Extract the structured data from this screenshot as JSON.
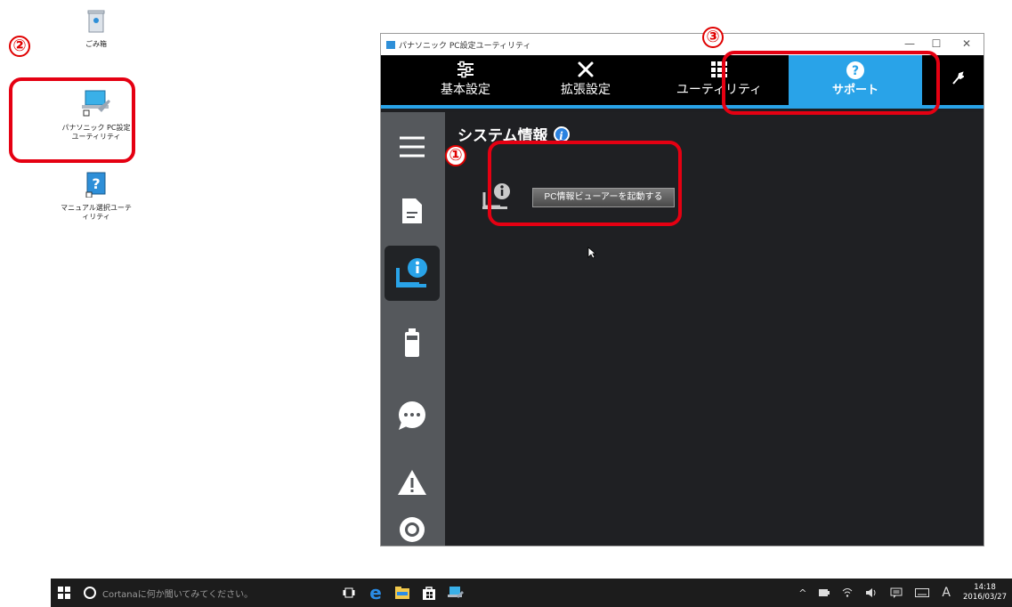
{
  "desktop": {
    "icons": [
      {
        "label": "ごみ箱"
      },
      {
        "label": "パナソニック PC設定\nユーティリティ"
      },
      {
        "label": "マニュアル選択ユーテ\nィリティ"
      }
    ]
  },
  "annotations": {
    "n1": "①",
    "n2": "②",
    "n3": "③"
  },
  "window": {
    "title": "パナソニック PC設定ユーティリティ",
    "controls": {
      "minimize": "—",
      "maximize": "☐",
      "close": "✕"
    },
    "tabs": [
      {
        "label": "基本設定",
        "icon": "sliders-icon"
      },
      {
        "label": "拡張設定",
        "icon": "tools-icon"
      },
      {
        "label": "ユーティリティ",
        "icon": "grid-icon"
      },
      {
        "label": "サポート",
        "icon": "question-icon"
      }
    ],
    "active_tab": "サポート",
    "section_title": "システム情報",
    "launch_button": "PC情報ビューアーを起動する"
  },
  "taskbar": {
    "search_placeholder": "Cortanaに何か聞いてみてください。",
    "time": "14:18",
    "date": "2016/03/27",
    "ime": "A"
  },
  "colors": {
    "accent": "#29a3e8",
    "annotation_red": "#e50012"
  }
}
